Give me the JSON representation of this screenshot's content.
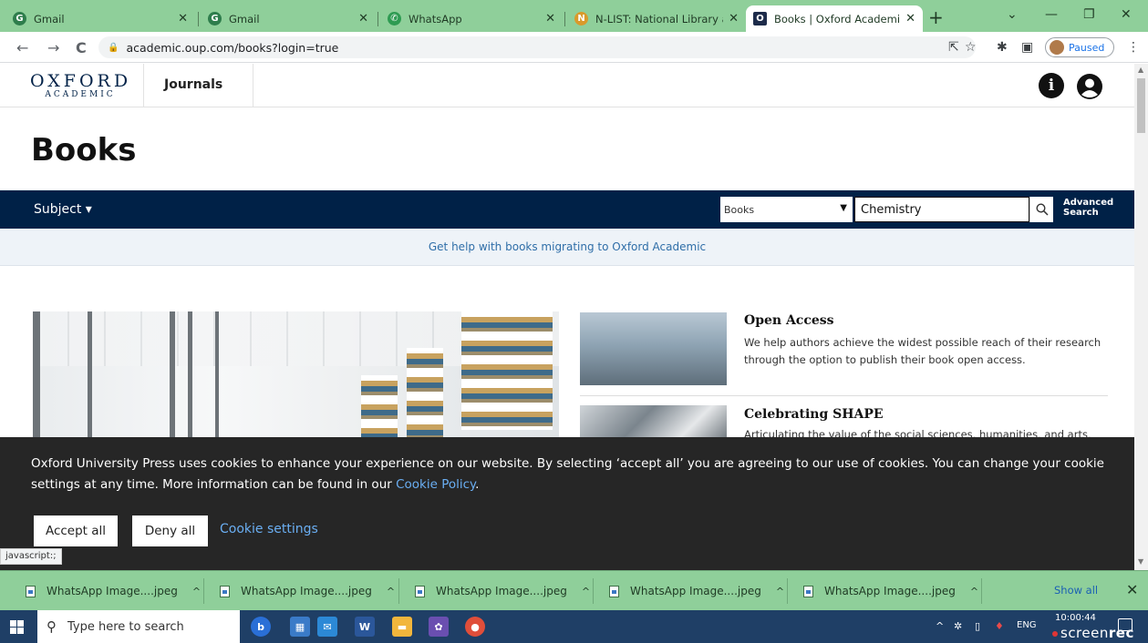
{
  "browser": {
    "tabs": [
      {
        "title": "Gmail",
        "icon": "gmail-icon",
        "letter": "G",
        "color": "#2e7d4c"
      },
      {
        "title": "Gmail",
        "icon": "gmail-icon",
        "letter": "G",
        "color": "#2e7d4c"
      },
      {
        "title": "WhatsApp",
        "icon": "whatsapp-icon",
        "letter": "✆",
        "color": "#2e9b52"
      },
      {
        "title": "N-LIST: National Library and",
        "icon": "nlist-icon",
        "letter": "N",
        "color": "#d99a2b"
      },
      {
        "title": "Books | Oxford Academic",
        "icon": "oxford-icon",
        "letter": "O",
        "color": "#1d2b4a"
      }
    ],
    "url": "academic.oup.com/books?login=true",
    "profile_status": "Paused"
  },
  "site": {
    "logo_line1": "OXFORD",
    "logo_line2": "ACADEMIC",
    "nav_journals": "Journals",
    "page_title": "Books",
    "subject_label": "Subject ▾",
    "search_scope": "Books",
    "search_value": "Chemistry",
    "advanced_line1": "Advanced",
    "advanced_line2": "Search",
    "help_text": "Get help with books migrating to Oxford Academic",
    "features": [
      {
        "title": "Open Access",
        "desc": "We help authors achieve the widest possible reach of their research through the option to publish their book open access."
      },
      {
        "title": "Celebrating SHAPE",
        "desc": "Articulating the value of the social sciences, humanities, and arts, and"
      }
    ]
  },
  "cookie": {
    "text_main": "Oxford University Press uses cookies to enhance your experience on our website. By selecting ‘accept all’ you are agreeing to our use of cookies. You can change your cookie settings at any time. More information can be found in our ",
    "policy_link": "Cookie Policy",
    "text_end": ".",
    "accept_label": "Accept all",
    "deny_label": "Deny all",
    "settings_label": "Cookie settings"
  },
  "status_bar": "javascript:;",
  "downloads": {
    "items": [
      "WhatsApp Image....jpeg",
      "WhatsApp Image....jpeg",
      "WhatsApp Image....jpeg",
      "WhatsApp Image....jpeg",
      "WhatsApp Image....jpeg"
    ],
    "show_all": "Show all"
  },
  "taskbar": {
    "search_placeholder": "Type here to search",
    "language": "ENG",
    "time": "10:00:44",
    "recorder_a": "screen",
    "recorder_b": "rec"
  },
  "colors": {
    "oxford_navy": "#002147",
    "tab_strip": "#8fcf9a",
    "cookie_bg": "#262626",
    "link_blue": "#6aaef2"
  }
}
